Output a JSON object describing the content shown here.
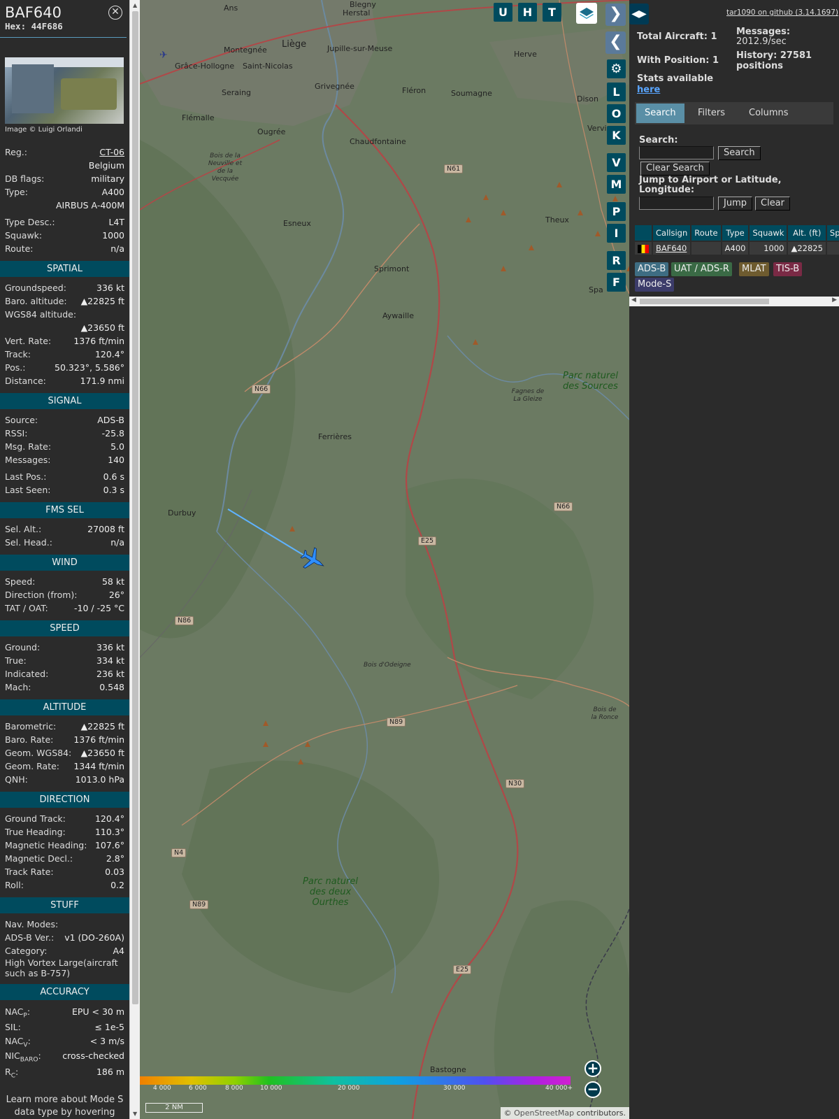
{
  "aircraft": {
    "callsign": "BAF640",
    "hex": "Hex: 44F686",
    "image_credit": "Image © Luigi Orlandi",
    "registration": "CT-06",
    "country": "Belgium",
    "db_flags": "military",
    "type": "A400",
    "type_full": "AIRBUS A-400M",
    "type_desc": "L4T",
    "squawk": "1000",
    "route": "n/a"
  },
  "labels": {
    "reg": "Reg.:",
    "db_flags": "DB flags:",
    "type": "Type:",
    "type_desc": "Type Desc.:",
    "squawk": "Squawk:",
    "route": "Route:"
  },
  "sections": {
    "spatial": {
      "title": "SPATIAL",
      "rows": [
        {
          "k": "Groundspeed:",
          "v": "336 kt"
        },
        {
          "k": "Baro. altitude:",
          "v": "▲22825 ft"
        },
        {
          "k": "WGS84 altitude:",
          "v": ""
        },
        {
          "k": "",
          "v": "▲23650 ft"
        },
        {
          "k": "Vert. Rate:",
          "v": "1376 ft/min"
        },
        {
          "k": "Track:",
          "v": "120.4°"
        },
        {
          "k": "Pos.:",
          "v": "50.323°, 5.586°"
        },
        {
          "k": "Distance:",
          "v": "171.9 nmi"
        }
      ]
    },
    "signal": {
      "title": "SIGNAL",
      "rows": [
        {
          "k": "Source:",
          "v": "ADS-B"
        },
        {
          "k": "RSSI:",
          "v": "-25.8"
        },
        {
          "k": "Msg. Rate:",
          "v": "5.0"
        },
        {
          "k": "Messages:",
          "v": "140"
        }
      ],
      "rows2": [
        {
          "k": "Last Pos.:",
          "v": "0.6 s"
        },
        {
          "k": "Last Seen:",
          "v": "0.3 s"
        }
      ]
    },
    "fms": {
      "title": "FMS SEL",
      "rows": [
        {
          "k": "Sel. Alt.:",
          "v": "27008 ft"
        },
        {
          "k": "Sel. Head.:",
          "v": "n/a"
        }
      ]
    },
    "wind": {
      "title": "WIND",
      "rows": [
        {
          "k": "Speed:",
          "v": "58 kt"
        },
        {
          "k": "Direction (from):",
          "v": "26°"
        },
        {
          "k": "TAT / OAT:",
          "v": "-10 / -25 °C"
        }
      ]
    },
    "speed": {
      "title": "SPEED",
      "rows": [
        {
          "k": "Ground:",
          "v": "336 kt"
        },
        {
          "k": "True:",
          "v": "334 kt"
        },
        {
          "k": "Indicated:",
          "v": "236 kt"
        },
        {
          "k": "Mach:",
          "v": "0.548"
        }
      ]
    },
    "altitude": {
      "title": "ALTITUDE",
      "rows": [
        {
          "k": "Barometric:",
          "v": "▲22825 ft"
        },
        {
          "k": "Baro. Rate:",
          "v": "1376 ft/min"
        },
        {
          "k": "Geom. WGS84:",
          "v": "▲23650 ft"
        },
        {
          "k": "Geom. Rate:",
          "v": "1344 ft/min"
        },
        {
          "k": "QNH:",
          "v": "1013.0 hPa"
        }
      ]
    },
    "direction": {
      "title": "DIRECTION",
      "rows": [
        {
          "k": "Ground Track:",
          "v": "120.4°"
        },
        {
          "k": "True Heading:",
          "v": "110.3°"
        },
        {
          "k": "Magnetic Heading:",
          "v": "107.6°"
        },
        {
          "k": "Magnetic Decl.:",
          "v": "2.8°"
        },
        {
          "k": "Track Rate:",
          "v": "0.03"
        },
        {
          "k": "Roll:",
          "v": "0.2"
        }
      ]
    },
    "stuff": {
      "title": "STUFF",
      "rows": [
        {
          "k": "Nav. Modes:",
          "v": ""
        },
        {
          "k": "ADS-B Ver.:",
          "v": "v1 (DO-260A)"
        },
        {
          "k": "Category:",
          "v": "A4"
        }
      ],
      "category_desc": "High Vortex Large(aircraft such as B-757)"
    },
    "accuracy": {
      "title": "ACCURACY",
      "nacp_k": "NAC",
      "nacp_sub": "P",
      "nacp_v": "EPU < 30 m",
      "sil_k": "SIL:",
      "sil_v": "≤ 1e-5",
      "nacv_k": "NAC",
      "nacv_sub": "V",
      "nacv_v": "< 3 m/s",
      "nicbaro_k": "NIC",
      "nicbaro_sub": "BARO",
      "nicbaro_v": "cross-checked",
      "rc_k": "R",
      "rc_sub": "C",
      "rc_v": "186 m"
    },
    "footer_note": "Learn more about Mode S data type by hovering over each data label"
  },
  "map": {
    "buttons": [
      "U",
      "H",
      "T"
    ],
    "side_buttons": [
      "L",
      "O",
      "K",
      "V",
      "M",
      "P",
      "I",
      "R",
      "F"
    ],
    "towns": [
      {
        "name": "Herstal"
      },
      {
        "name": "Ans"
      },
      {
        "name": "Liège"
      },
      {
        "name": "Jupille-sur-Meuse"
      },
      {
        "name": "Montegnée"
      },
      {
        "name": "Grâce-Hollogne"
      },
      {
        "name": "Saint-Nicolas"
      },
      {
        "name": "Seraing"
      },
      {
        "name": "Grivegnée"
      },
      {
        "name": "Fléron"
      },
      {
        "name": "Soumagne"
      },
      {
        "name": "Herve"
      },
      {
        "name": "Dison"
      },
      {
        "name": "Verviers"
      },
      {
        "name": "Flémalle"
      },
      {
        "name": "Ougrée"
      },
      {
        "name": "Chaudfontaine"
      },
      {
        "name": "Esneux"
      },
      {
        "name": "Theux"
      },
      {
        "name": "Sprimont"
      },
      {
        "name": "Aywaille"
      },
      {
        "name": "Spa"
      },
      {
        "name": "Ferrières"
      },
      {
        "name": "Durbuy"
      },
      {
        "name": "Bastogne"
      },
      {
        "name": "Blegny"
      }
    ],
    "roads": [
      "N61",
      "N66",
      "N66",
      "E25",
      "N86",
      "N89",
      "N30",
      "N4",
      "N89",
      "E25"
    ],
    "parks": {
      "deux_ourthes": "Parc naturel des deux Ourthes",
      "sources": "Parc naturel des Sources",
      "neuville": "Bois de la Neuville et de la Vecquée",
      "odeigne": "Bois d'Odeigne",
      "fagnes": "Fagnes de La Gleize",
      "ronce": "Bois de la Ronce"
    },
    "colorbar_ticks": [
      "4 000",
      "6 000",
      "8 000",
      "10 000",
      "20 000",
      "30 000",
      "40 000+"
    ],
    "scale": "2 NM",
    "attribution_prefix": "© ",
    "attribution_link": "OpenStreetMap",
    "attribution_suffix": " contributors."
  },
  "sidebar": {
    "github": "tar1090 on github (3.14.1697)",
    "total_aircraft": "Total Aircraft: 1",
    "with_position": "With Position: 1",
    "stats_available": "Stats available",
    "stats_link": "here",
    "messages_label": "Messages:",
    "messages_value": "2012.9/sec",
    "history": "History: 27581 positions",
    "tabs": [
      "Search",
      "Filters",
      "Columns"
    ],
    "search_label": "Search:",
    "search_button": "Search",
    "clear_search_button": "Clear Search",
    "jump_label": "Jump to Airport or Latitude, Longitude:",
    "jump_button": "Jump",
    "clear_button": "Clear",
    "table_headers": [
      "",
      "Callsign",
      "Route",
      "Type",
      "Squawk",
      "Alt. (ft)",
      "Spd"
    ],
    "table_rows": [
      {
        "callsign": "BAF640",
        "route": "",
        "type": "A400",
        "squawk": "1000",
        "alt": "▲22825",
        "spd": ""
      }
    ],
    "legend": [
      {
        "label": "ADS-B",
        "color": "#3e6d83"
      },
      {
        "label": "UAT / ADS-R",
        "color": "#3a6a45"
      },
      {
        "label": "MLAT",
        "color": "#6e5b2f"
      },
      {
        "label": "TIS-B",
        "color": "#7a2a45"
      },
      {
        "label": "Mode-S",
        "color": "#3c3c6a"
      }
    ]
  }
}
